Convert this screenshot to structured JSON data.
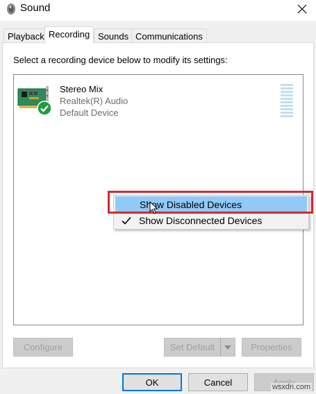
{
  "window": {
    "title": "Sound",
    "icon": "speaker-icon",
    "close_icon": "close-icon"
  },
  "tabs": [
    {
      "label": "Playback",
      "active": false
    },
    {
      "label": "Recording",
      "active": true
    },
    {
      "label": "Sounds",
      "active": false
    },
    {
      "label": "Communications",
      "active": false
    }
  ],
  "recording": {
    "instruction": "Select a recording device below to modify its settings:",
    "devices": [
      {
        "name": "Stereo Mix",
        "driver": "Realtek(R) Audio",
        "status": "Default Device",
        "icon": "sound-card-icon",
        "badge": "default-checkmark-icon"
      }
    ]
  },
  "context_menu": {
    "items": [
      {
        "label": "Show Disabled Devices",
        "checked": false,
        "hovered": true
      },
      {
        "label": "Show Disconnected Devices",
        "checked": true,
        "hovered": false
      }
    ]
  },
  "buttons": {
    "configure": "Configure",
    "set_default": "Set Default",
    "properties": "Properties",
    "ok": "OK",
    "cancel": "Cancel",
    "apply": "Apply"
  },
  "watermark": "wsxdn.com",
  "colors": {
    "highlight_box": "#d12a30",
    "menu_hover": "#91c9f7",
    "ok_border": "#0078d7",
    "badge_green": "#1e9e3c"
  }
}
